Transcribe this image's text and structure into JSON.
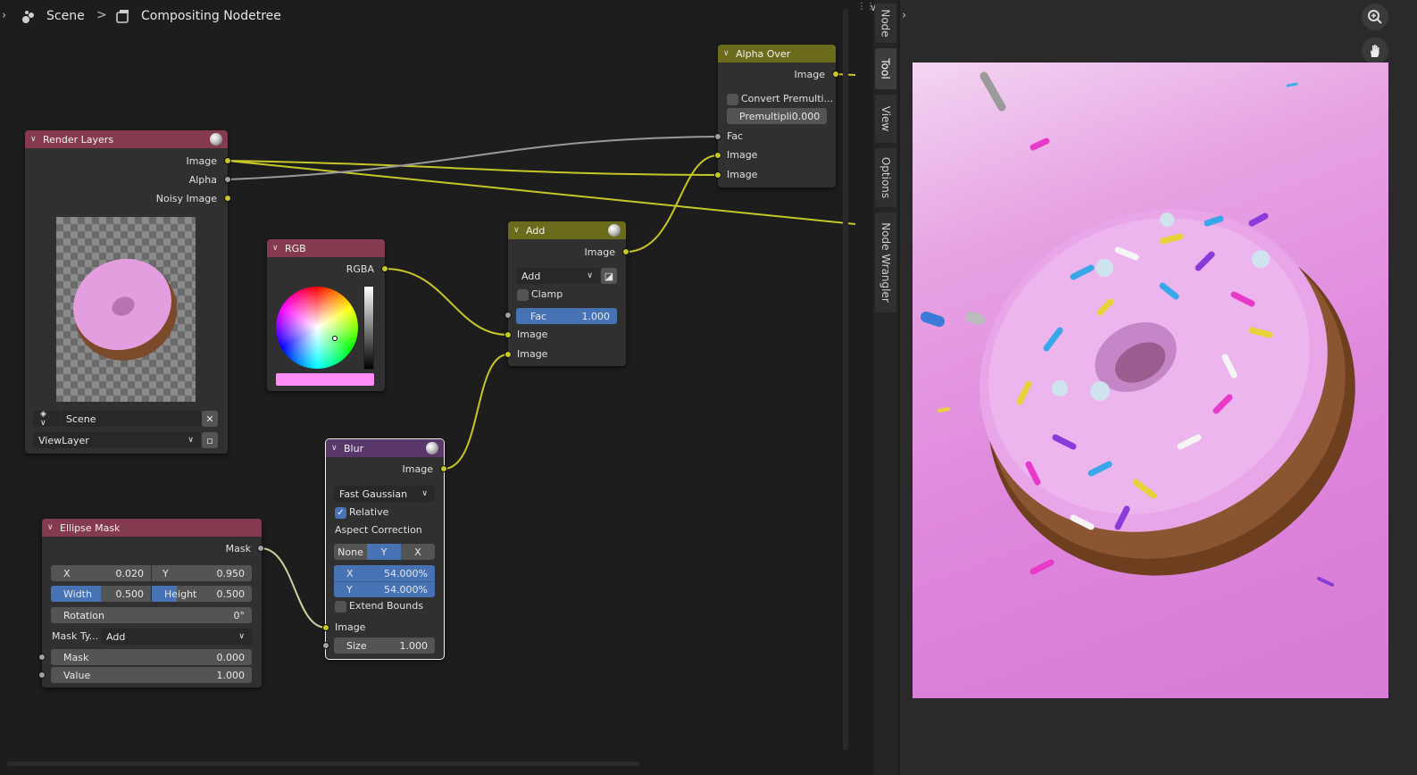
{
  "header": {
    "scene": "Scene",
    "nodetree": "Compositing Nodetree"
  },
  "nodes": {
    "render_layers": {
      "title": "Render Layers",
      "outputs": [
        "Image",
        "Alpha",
        "Noisy Image"
      ],
      "scene_field": "Scene",
      "layer_field": "ViewLayer"
    },
    "rgb": {
      "title": "RGB",
      "output": "RGBA",
      "swatch_color": "#ff8df5"
    },
    "add": {
      "title": "Add",
      "output": "Image",
      "blend_mode": "Add",
      "clamp_label": "Clamp",
      "fac_label": "Fac",
      "fac_value": "1.000",
      "inputs": [
        "Image",
        "Image"
      ]
    },
    "alpha_over": {
      "title": "Alpha Over",
      "output": "Image",
      "convert_label": "Convert Premulti...",
      "premul_label": "Premultipli",
      "premul_value": "0.000",
      "inputs": [
        "Fac",
        "Image",
        "Image"
      ]
    },
    "blur": {
      "title": "Blur",
      "output": "Image",
      "filter_type": "Fast Gaussian",
      "relative_label": "Relative",
      "aspect_label": "Aspect Correction",
      "aspect_options": [
        "None",
        "Y",
        "X"
      ],
      "x_label": "X",
      "x_value": "54.000%",
      "y_label": "Y",
      "y_value": "54.000%",
      "extend_label": "Extend Bounds",
      "input": "Image",
      "size_label": "Size",
      "size_value": "1.000"
    },
    "ellipse_mask": {
      "title": "Ellipse Mask",
      "output": "Mask",
      "x_label": "X",
      "x_value": "0.020",
      "y_label": "Y",
      "y_value": "0.950",
      "width_label": "Width",
      "width_value": "0.500",
      "height_label": "Height",
      "height_value": "0.500",
      "rotation_label": "Rotation",
      "rotation_value": "0°",
      "mask_type_label": "Mask Ty...",
      "mask_type_value": "Add",
      "mask_label": "Mask",
      "mask_value": "0.000",
      "value_label": "Value",
      "value_value": "1.000"
    }
  },
  "sidebar_tabs": [
    "Node",
    "Tool",
    "View",
    "Options",
    "Node Wrangler"
  ],
  "colors": {
    "render_layers_header": "#853b4f",
    "rgb_header": "#853b4f",
    "add_header": "#6b6b1c",
    "alpha_over_header": "#6b6b1c",
    "blur_header": "#59376a",
    "ellipse_mask_header": "#853b4f",
    "image_socket": "#c7c729",
    "value_socket": "#a1a1a1",
    "render_background": "#df86dd"
  },
  "icons": [
    "scene-icon",
    "nodetree-icon",
    "zoom-icon",
    "hand-icon",
    "world-icon",
    "browse-icon",
    "close-icon"
  ]
}
